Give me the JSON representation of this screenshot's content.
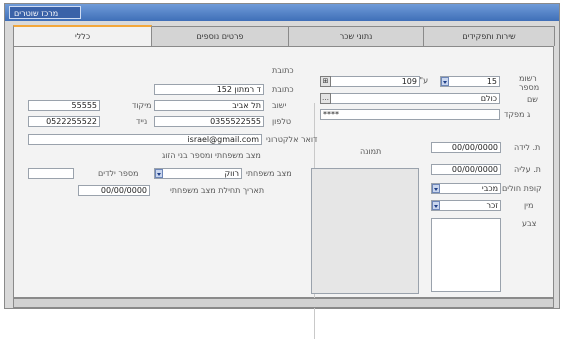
{
  "window": {
    "title": "מרכז שוטרים"
  },
  "tabs": [
    {
      "label": "שירות ותפקידים"
    },
    {
      "label": "נתוני שכר"
    },
    {
      "label": "פרטים נוספים"
    },
    {
      "label": "כללי"
    }
  ],
  "left": {
    "id_label": "מספר",
    "id_label_top": "רשומ",
    "id_value": "15",
    "rank_value": "109",
    "rank_suffix": "ע\"מ",
    "name_label": "שם",
    "name_value": "כולם",
    "password_label": "ג מפקד",
    "password_value": "****",
    "birth_label": "ת. לידה",
    "birth_value": "00/00/0000",
    "aliyah_label": "ת. עליה",
    "aliyah_value": "00/00/0000",
    "kupa_label": "קופת חולים",
    "kupa_value": "מכבי",
    "gender_label": "מין",
    "gender_value": "זכר",
    "color_label": "צבע",
    "photo_label": "תמונה"
  },
  "right": {
    "section_label": "כתובת",
    "address_label": "כתובת",
    "address_value": "ד רמתון 152",
    "city_label": "ישוב",
    "city_value": "תל אביב",
    "zip_label": "מיקוד",
    "zip_value": "55555",
    "phone_label": "טלפון",
    "phone_value": "0355522555",
    "mobile_label": "נייד",
    "mobile_value": "0522255522",
    "email_label": "דואר אלקטרוני",
    "email_value": "israel@gmail.com",
    "family_section_label": "מצב משפחתי ומספר בני הזוג",
    "marital_label": "מצב משפחתי",
    "marital_value": "רווק",
    "children_label": "מספר ילדים",
    "children_value": "",
    "marital_date_label": "תאריך תחילת מצב משפחתי",
    "marital_date_value": "00/00/0000"
  }
}
